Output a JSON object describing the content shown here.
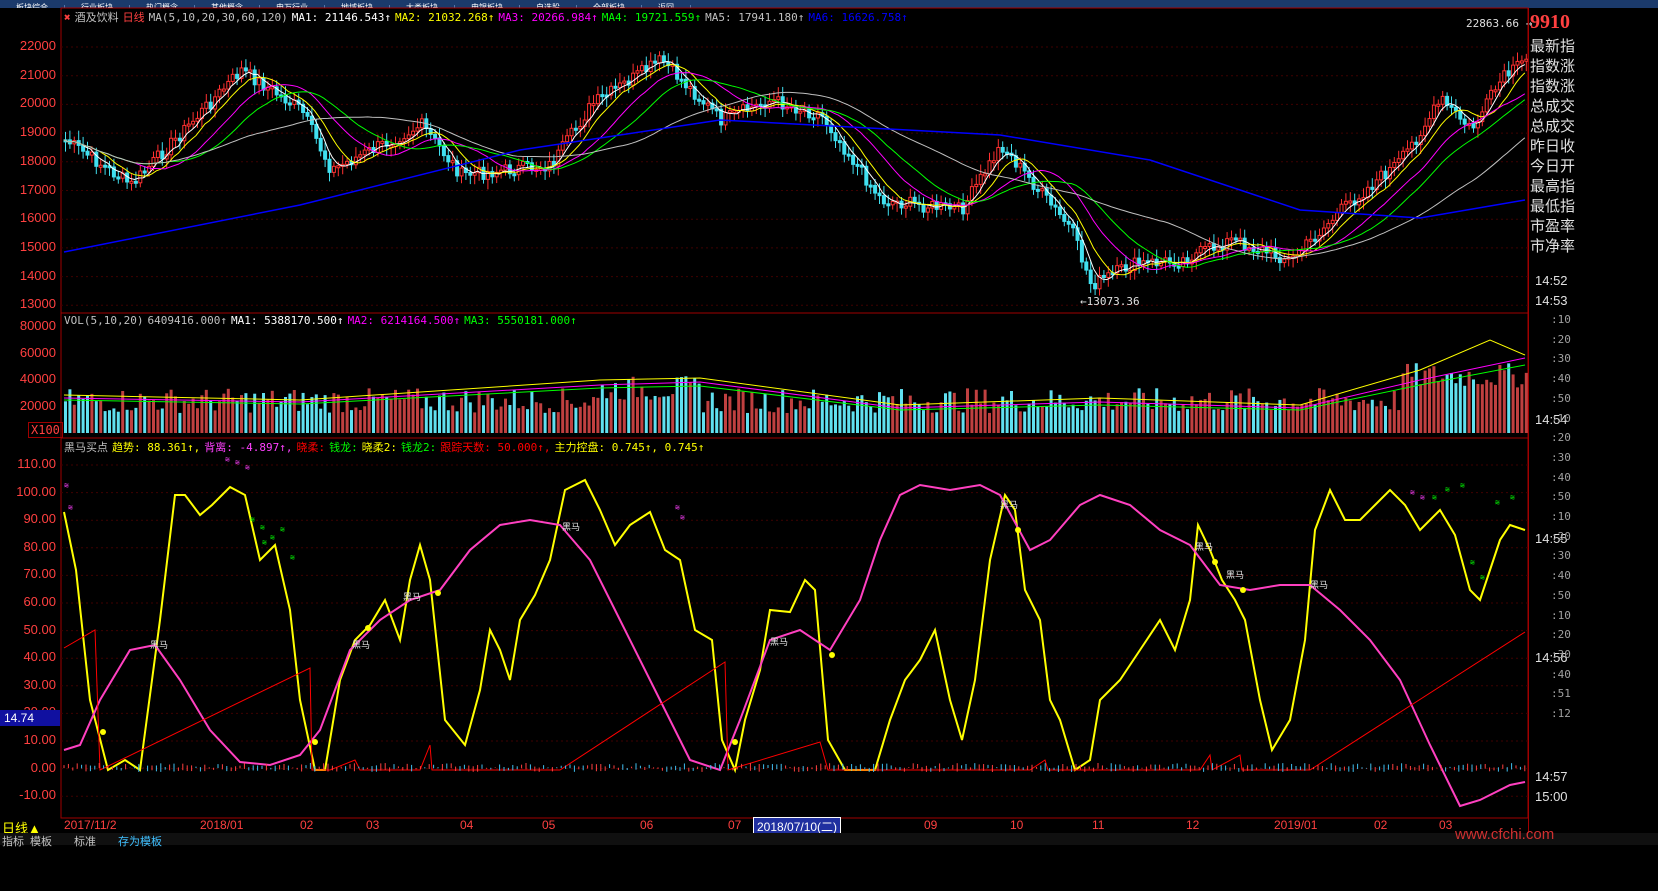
{
  "top_tabs": [
    "板块综合",
    "行业板块",
    "热门概念",
    "其他概念",
    "申万行业",
    "地域板块",
    "大类板块",
    "申银板块",
    "自选股",
    "全部板块",
    "返回"
  ],
  "main": {
    "title": "酒及饮料",
    "period": "日线",
    "ma_params": "MA(5,10,20,30,60,120)",
    "ma_values": [
      {
        "label": "MA1: 21146.543↑",
        "color": "#ffffff"
      },
      {
        "label": "MA2: 21032.268↑",
        "color": "#ffff00"
      },
      {
        "label": "MA3: 20266.984↑",
        "color": "#ff00ff"
      },
      {
        "label": "MA4: 19721.559↑",
        "color": "#00ff00"
      },
      {
        "label": "MA5: 17941.180↑",
        "color": "#c0c0c0"
      },
      {
        "label": "MA6: 16626.758↑",
        "color": "#0000ff"
      }
    ],
    "y_labels": [
      "22000",
      "21000",
      "20000",
      "19000",
      "18000",
      "17000",
      "16000",
      "15000",
      "14000",
      "13000"
    ],
    "high_marker": "22863.66",
    "low_marker": "13073.36"
  },
  "volume": {
    "title": "VOL(5,10,20)",
    "value": "6409416.000↑",
    "ma_values": [
      {
        "label": "MA1: 5388170.500↑",
        "color": "#ffffff"
      },
      {
        "label": "MA2: 6214164.500↑",
        "color": "#ff00ff"
      },
      {
        "label": "MA3: 5550181.000↑",
        "color": "#00ff00"
      }
    ],
    "y_labels": [
      "80000",
      "60000",
      "40000",
      "20000"
    ],
    "unit": "X100"
  },
  "indicator": {
    "title": "黑马买点",
    "items": [
      {
        "label": "趋势: 88.361↑,",
        "color": "#ffff00"
      },
      {
        "label": "背离: -4.897↑,",
        "color": "#ff40ff"
      },
      {
        "label": "晓柔:",
        "color": "#ff0000"
      },
      {
        "label": "钱龙:",
        "color": "#00ff00"
      },
      {
        "label": "晓柔2:",
        "color": "#ffff00"
      },
      {
        "label": "钱龙2:",
        "color": "#00ff00"
      },
      {
        "label": "跟踪天数: 50.000↑,",
        "color": "#ff0000"
      },
      {
        "label": "主力控盘: 0.745↑, 0.745↑",
        "color": "#ffff00"
      }
    ],
    "y_labels": [
      "110.00",
      "100.00",
      "90.00",
      "80.00",
      "70.00",
      "60.00",
      "50.00",
      "40.00",
      "30.00",
      "20.00",
      "10.00",
      "0.00",
      "-10.00"
    ],
    "cursor_value": "14.74",
    "tag": "黑马"
  },
  "x_labels": [
    "2017/11/2",
    "2018/01",
    "02",
    "03",
    "04",
    "05",
    "06",
    "07",
    "09",
    "10",
    "11",
    "12",
    "2019/01",
    "02",
    "03"
  ],
  "cursor_date": "2018/07/10(二)",
  "right_panel": {
    "price": "9910",
    "info_rows": [
      "最新指",
      "指数涨",
      "指数涨",
      "总成交",
      "总成交",
      "昨日收",
      "今日开",
      "最高指",
      "最低指",
      "市盈率",
      "市净率"
    ],
    "times": [
      "14:52",
      "14:53",
      "14:54",
      "14:55",
      "14:56",
      "14:57",
      "15:00"
    ],
    "small_rows": [
      ":10",
      ":20",
      ":30",
      ":40",
      ":50",
      ":10",
      ":20",
      ":30",
      ":40",
      ":50",
      ":10",
      ":20",
      ":30",
      ":40",
      ":50",
      ":10",
      ":20",
      ":30",
      ":40",
      ":51",
      ":12"
    ]
  },
  "bottom_bar": [
    "指标",
    "模板",
    "标准",
    "存为模板"
  ],
  "watermark": "www.cfchi.com"
}
